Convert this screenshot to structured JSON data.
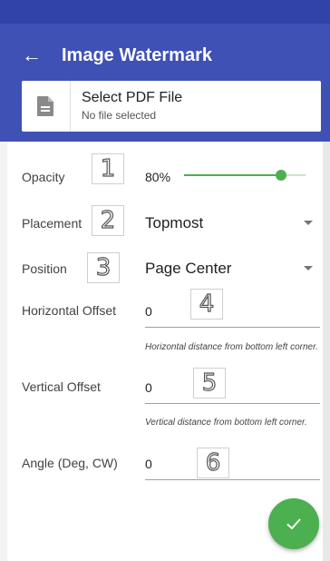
{
  "app": {
    "title": "Image Watermark"
  },
  "file": {
    "label": "Select PDF File",
    "status": "No file selected"
  },
  "opacity": {
    "label": "Opacity",
    "value_text": "80%",
    "value": 0.8,
    "marker": "1"
  },
  "placement": {
    "label": "Placement",
    "selected": "Topmost",
    "marker": "2"
  },
  "position": {
    "label": "Position",
    "selected": "Page Center",
    "marker": "3"
  },
  "horizontal_offset": {
    "label": "Horizontal Offset",
    "value": "0",
    "hint": "Horizontal distance from bottom left corner.",
    "marker": "4"
  },
  "vertical_offset": {
    "label": "Vertical Offset",
    "value": "0",
    "hint": "Vertical distance from bottom left corner.",
    "marker": "5"
  },
  "angle": {
    "label": "Angle (Deg, CW)",
    "value": "0",
    "marker": "6"
  },
  "icons": {
    "back": "arrow-left-icon",
    "file": "document-icon",
    "confirm": "check-icon"
  },
  "colors": {
    "primary": "#3f51b5",
    "primary_dark": "#3142a8",
    "accent": "#4caf50"
  }
}
